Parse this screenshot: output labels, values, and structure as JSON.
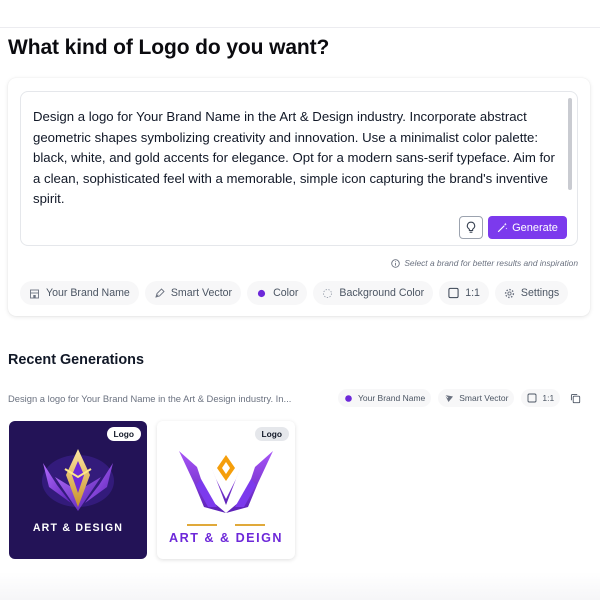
{
  "page": {
    "title": "What kind of Logo do you want?"
  },
  "prompt": {
    "text": "Design a logo for Your Brand Name in the Art & Design industry. Incorporate abstract geometric shapes symbolizing creativity and innovation. Use a minimalist color palette: black, white, and gold accents for elegance. Opt for a modern sans-serif typeface. Aim for a clean, sophisticated feel with a memorable, simple icon capturing the brand's inventive spirit.",
    "hint_icon": "lightbulb-icon",
    "generate_label": "Generate",
    "generate_icon": "magic-wand-icon",
    "brand_hint": "Select a brand for better results and inspiration"
  },
  "options": [
    {
      "name": "brand",
      "icon": "building-icon",
      "label": "Your Brand Name"
    },
    {
      "name": "style",
      "icon": "vector-pen-icon",
      "label": "Smart Vector"
    },
    {
      "name": "color",
      "icon": "filled-dot-icon",
      "label": "Color"
    },
    {
      "name": "background",
      "icon": "dotted-circle-icon",
      "label": "Background Color"
    },
    {
      "name": "ratio",
      "icon": "square-icon",
      "label": "1:1"
    },
    {
      "name": "settings",
      "icon": "gear-icon",
      "label": "Settings"
    }
  ],
  "recent": {
    "title": "Recent Generations",
    "prompt_preview": "Design a logo for Your Brand Name in the Art & Design industry. In...",
    "brand": "Your Brand Name",
    "style": "Smart Vector",
    "ratio": "1:1",
    "items": [
      {
        "badge": "Logo",
        "text": "ART & DESIGN"
      },
      {
        "badge": "Logo",
        "text": "ART & & DEIGN"
      }
    ]
  },
  "colors": {
    "accent": "#7c3aed",
    "dark_tile": "#231357",
    "gold": "#e0a93a"
  }
}
